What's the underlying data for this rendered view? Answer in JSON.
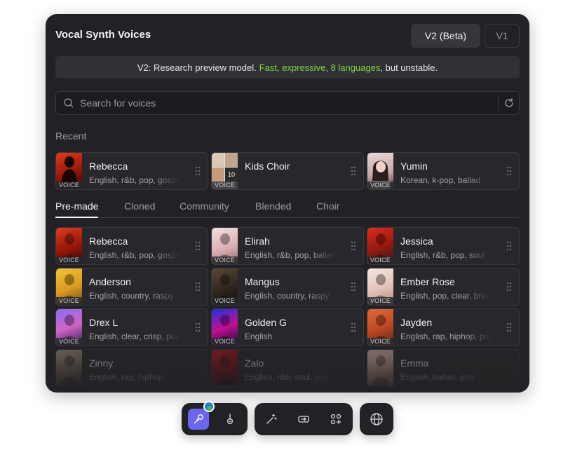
{
  "header": {
    "title": "Vocal Synth Voices",
    "version_buttons": [
      "V2 (Beta)",
      "V1"
    ]
  },
  "banner": {
    "prefix": "V2: Research preview model.",
    "highlight": "Fast, expressive, 8 languages",
    "suffix": ", but unstable."
  },
  "search": {
    "placeholder": "Search for voices"
  },
  "recent": {
    "label": "Recent",
    "items": [
      {
        "name": "Rebecca",
        "desc": "English, r&b, pop, gospel",
        "badge": "VOICE"
      },
      {
        "name": "Kids Choir",
        "desc": "",
        "badge": "VOICE",
        "count": "10"
      },
      {
        "name": "Yumin",
        "desc": "Korean, k-pop, ballad",
        "badge": "VOICE"
      }
    ]
  },
  "tabs": [
    "Pre-made",
    "Cloned",
    "Community",
    "Blended",
    "Choir"
  ],
  "voices": [
    {
      "name": "Rebecca",
      "desc": "English, r&b, pop, gospel",
      "badge": "VOICE"
    },
    {
      "name": "Elirah",
      "desc": "English, r&b, pop, ballad",
      "badge": "VOICE"
    },
    {
      "name": "Jessica",
      "desc": "English, r&b, pop, soul",
      "badge": "VOICE"
    },
    {
      "name": "Anderson",
      "desc": "English, country, raspy",
      "badge": "VOICE"
    },
    {
      "name": "Mangus",
      "desc": "English, country, raspy",
      "badge": "VOICE"
    },
    {
      "name": "Ember Rose",
      "desc": "English, pop, clear, breathy",
      "badge": "VOICE"
    },
    {
      "name": "Drex L",
      "desc": "English, clear, crisp, pop",
      "badge": "VOICE"
    },
    {
      "name": "Golden G",
      "desc": "English",
      "badge": "VOICE"
    },
    {
      "name": "Jayden",
      "desc": "English, rap, hiphop, pop",
      "badge": "VOICE"
    },
    {
      "name": "Zinny",
      "desc": "English, rap, hiphop",
      "badge": ""
    },
    {
      "name": "Zalo",
      "desc": "English, r&b, soul, pop",
      "badge": ""
    },
    {
      "name": "Emma",
      "desc": "English, ballad, pop",
      "badge": ""
    }
  ],
  "colors": {
    "accent": "#6b66f0",
    "highlight": "#7ddc3e",
    "panel": "#222226"
  }
}
